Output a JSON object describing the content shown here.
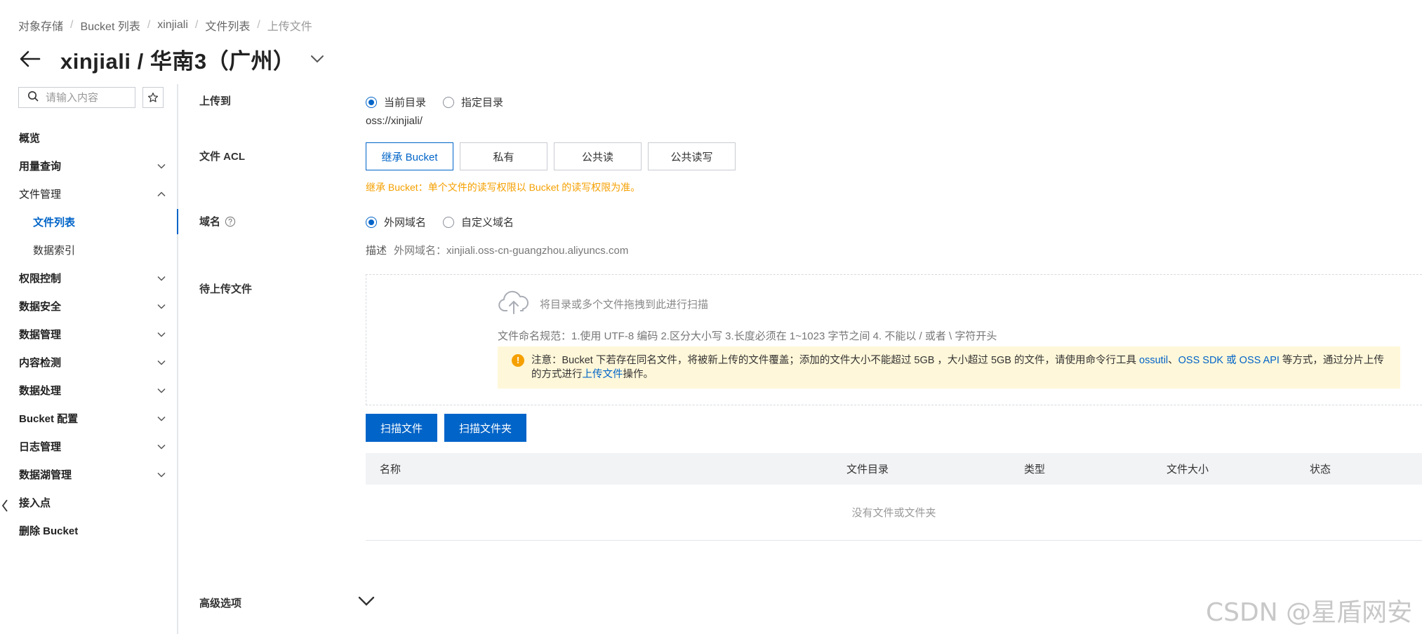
{
  "breadcrumb": [
    "对象存储",
    "Bucket 列表",
    "xinjiali",
    "文件列表",
    "上传文件"
  ],
  "page_title": "xinjiali / 华南3（广州）",
  "sidebar": {
    "search_placeholder": "请输入内容",
    "items": [
      {
        "label": "概览",
        "type": "plain-bold"
      },
      {
        "label": "用量查询",
        "type": "group",
        "chevron": "down"
      },
      {
        "label": "文件管理",
        "type": "group-open",
        "chevron": "up"
      },
      {
        "label": "文件列表",
        "type": "sub-active"
      },
      {
        "label": "数据索引",
        "type": "sub"
      },
      {
        "label": "权限控制",
        "type": "group",
        "chevron": "down"
      },
      {
        "label": "数据安全",
        "type": "group",
        "chevron": "down"
      },
      {
        "label": "数据管理",
        "type": "group",
        "chevron": "down"
      },
      {
        "label": "内容检测",
        "type": "group",
        "chevron": "down"
      },
      {
        "label": "数据处理",
        "type": "group",
        "chevron": "down"
      },
      {
        "label": "Bucket 配置",
        "type": "group",
        "chevron": "down"
      },
      {
        "label": "日志管理",
        "type": "group",
        "chevron": "down"
      },
      {
        "label": "数据湖管理",
        "type": "group",
        "chevron": "down"
      },
      {
        "label": "接入点",
        "type": "plain-bold"
      },
      {
        "label": "删除 Bucket",
        "type": "plain-bold"
      }
    ]
  },
  "form": {
    "upload_to": {
      "label": "上传到",
      "options": [
        "当前目录",
        "指定目录"
      ],
      "selected": "当前目录",
      "path": "oss://xinjiali/"
    },
    "acl": {
      "label": "文件 ACL",
      "options": [
        "继承 Bucket",
        "私有",
        "公共读",
        "公共读写"
      ],
      "selected": "继承 Bucket",
      "note": "继承 Bucket：单个文件的读写权限以 Bucket 的读写权限为准。"
    },
    "domain": {
      "label": "域名",
      "options": [
        "外网域名",
        "自定义域名"
      ],
      "selected": "外网域名",
      "desc_label": "描述",
      "desc_value": "外网域名：xinjiali.oss-cn-guangzhou.aliyuncs.com"
    },
    "pending": {
      "label": "待上传文件",
      "drop_hint": "将目录或多个文件拖拽到此进行扫描",
      "naming_rule": "文件命名规范：1.使用 UTF-8 编码 2.区分大小写 3.长度必须在 1~1023 字节之间 4. 不能以 / 或者 \\ 字符开头",
      "warning": {
        "prefix": "注意：Bucket 下若存在同名文件，将被新上传的文件覆盖；添加的文件大小不能超过 5GB ，大小超过 5GB 的文件，请使用命令行工具 ",
        "link1": "ossutil",
        "sep1": "、",
        "link2": "OSS SDK",
        "sep2": " 或 ",
        "link3": "OSS API",
        "middle": " 等方式，通过分片上传的方式进行",
        "link4": "上传文件",
        "suffix": "操作。"
      }
    },
    "buttons": {
      "scan_files": "扫描文件",
      "scan_folder": "扫描文件夹"
    },
    "table": {
      "columns": [
        "名称",
        "文件目录",
        "类型",
        "文件大小",
        "状态"
      ],
      "empty": "没有文件或文件夹"
    },
    "advanced": "高级选项"
  },
  "watermark": "CSDN @星盾网安",
  "colors": {
    "accent": "#0064c8",
    "warning": "#f5a000",
    "warning_bg": "#fff7d9"
  }
}
